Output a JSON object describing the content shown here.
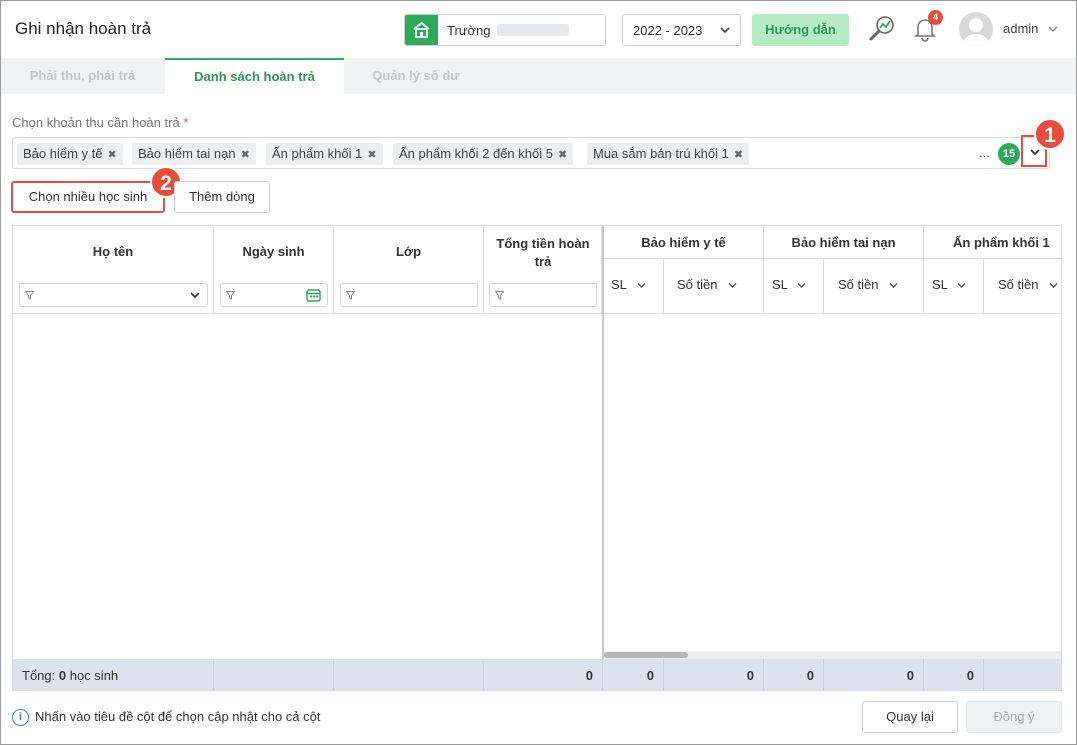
{
  "header": {
    "title": "Ghi nhận hoàn trả",
    "school_label": "Trường",
    "year": "2022 - 2023",
    "guide_label": "Hướng dẫn",
    "notification_count": "4",
    "user": "admin"
  },
  "tabs": [
    {
      "label": "Phải thu, phải trả",
      "active": false
    },
    {
      "label": "Danh sách hoàn trả",
      "active": true
    },
    {
      "label": "Quản lý số dư",
      "active": false
    }
  ],
  "selector": {
    "label": "Chọn khoản thu cần hoàn trả",
    "required_mark": "*",
    "tags": [
      "Bảo hiểm y tế",
      "Bảo hiểm tai nạn",
      "Ấn phẩm khối 1",
      "Ấn phẩm khối 2 đến khối 5",
      "Mua sắm bán trú khối 1"
    ],
    "remove_glyph": "✖",
    "more": "...",
    "count": "15"
  },
  "markers": {
    "m1": "1",
    "m2": "2"
  },
  "actions": {
    "choose_students": "Chọn nhiều học sinh",
    "add_row": "Thêm dòng"
  },
  "grid": {
    "columns": {
      "name": "Họ tên",
      "dob": "Ngày sinh",
      "class": "Lớp",
      "total": "Tổng tiền hoàn trả",
      "group1": "Bảo hiểm y tế",
      "group2": "Bảo hiểm tai nạn",
      "group3": "Ấn phẩm khối 1",
      "sl": "SL",
      "amount": "Số tiền"
    },
    "footer": {
      "label_prefix": "Tổng:",
      "count": "0",
      "label_suffix": "học sinh",
      "total": "0",
      "g1_sl": "0",
      "g1_amount": "0",
      "g2_sl": "0",
      "g2_amount": "0",
      "g3_sl": "0"
    }
  },
  "bottom": {
    "hint": "Nhấn vào tiêu đề cột để chọn cập nhật cho cả cột",
    "back": "Quay lại",
    "agree": "Đồng ý"
  },
  "colors": {
    "accent": "#2bab5c",
    "marker": "#e84c3d",
    "footer_bg": "#dde3ec"
  }
}
